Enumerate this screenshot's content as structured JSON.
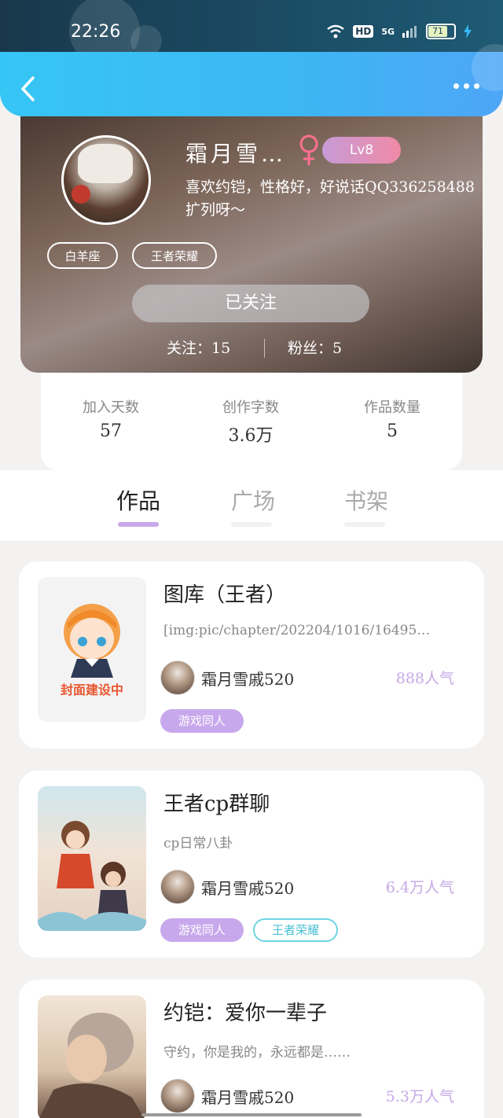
{
  "status_bar": {
    "time": "22:26",
    "network": "5G",
    "hd_label": "HD",
    "battery": "71"
  },
  "app_bar": {
    "back_icon": "back-arrow-icon",
    "more_icon": "more-dots-icon"
  },
  "profile": {
    "username": "霜月雪…",
    "gender_icon": "female-icon",
    "level": "Lv8",
    "bio_line1": "喜欢约铠，性格好，好说话QQ336258488",
    "bio_line2": "扩列呀～",
    "tags": [
      "白羊座",
      "王者荣耀"
    ],
    "follow_button": "已关注",
    "following": "关注：15",
    "fans": "粉丝：5"
  },
  "summary": [
    {
      "label": "加入天数",
      "value": "57"
    },
    {
      "label": "创作字数",
      "value": "3.6万"
    },
    {
      "label": "作品数量",
      "value": "5"
    }
  ],
  "tabs": [
    {
      "label": "作品",
      "active": true
    },
    {
      "label": "广场",
      "active": false
    },
    {
      "label": "书架",
      "active": false
    }
  ],
  "works": [
    {
      "title": "图库（王者）",
      "description": "[img:pic/chapter/202204/1016/16495…",
      "cover_text": "封面建设中",
      "author": "霜月雪戚520",
      "popularity": "888人气",
      "tags": [
        {
          "label": "游戏同人",
          "style": "purple"
        }
      ]
    },
    {
      "title": "王者cp群聊",
      "description": "cp日常八卦",
      "author": "霜月雪戚520",
      "popularity": "6.4万人气",
      "tags": [
        {
          "label": "游戏同人",
          "style": "purple"
        },
        {
          "label": "王者荣耀",
          "style": "outline"
        }
      ]
    },
    {
      "title": "约铠：爱你一辈子",
      "description": "守约，你是我的，永远都是……",
      "author": "霜月雪戚520",
      "popularity": "5.3万人气",
      "tags": []
    }
  ],
  "colors": {
    "accent_purple": "#c8a8ec",
    "popularity_purple": "#c6a8e6",
    "app_bar_blue": "#3db6f3",
    "tag_cyan": "#6fd4e3"
  }
}
